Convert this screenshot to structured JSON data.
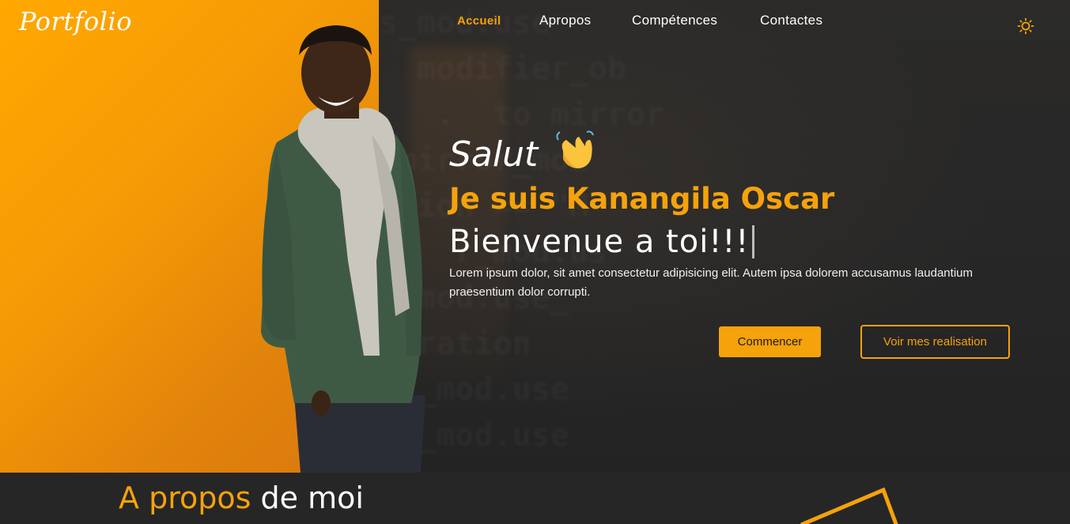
{
  "brand": {
    "logo": "Portfolio"
  },
  "nav": {
    "items": [
      {
        "label": "Accueil",
        "active": true
      },
      {
        "label": "Apropos",
        "active": false
      },
      {
        "label": "Compétences",
        "active": false
      },
      {
        "label": "Contactes",
        "active": false
      }
    ],
    "theme_toggle_icon": "sun-icon"
  },
  "hero": {
    "greeting": "Salut",
    "greeting_icon": "waving-hand-icon",
    "name": "Je suis Kanangila Oscar",
    "welcome": "Bienvenue a toi!!!",
    "description": "Lorem ipsum dolor, sit amet consectetur adipisicing elit. Autem ipsa dolorem accusamus laudantium praesentium dolor corrupti.",
    "primary_button": "Commencer",
    "secondary_button": "Voir mes realisation"
  },
  "background_code": [
    "s_mod.use",
    "  modifier_ob",
    "   .  to mirror",
    " mirror_mod",
    "  ion == \"M",
    "    r_mod.us",
    " _mod.use_",
    " eration",
    " r_mod.use",
    " r_mod.use"
  ],
  "about": {
    "title_accent": "A propos",
    "title_rest": " de moi"
  },
  "colors": {
    "accent": "#f5a20b",
    "dark_bg": "#262626",
    "gradient_start": "#ffa800",
    "gradient_end": "#d9780e"
  }
}
